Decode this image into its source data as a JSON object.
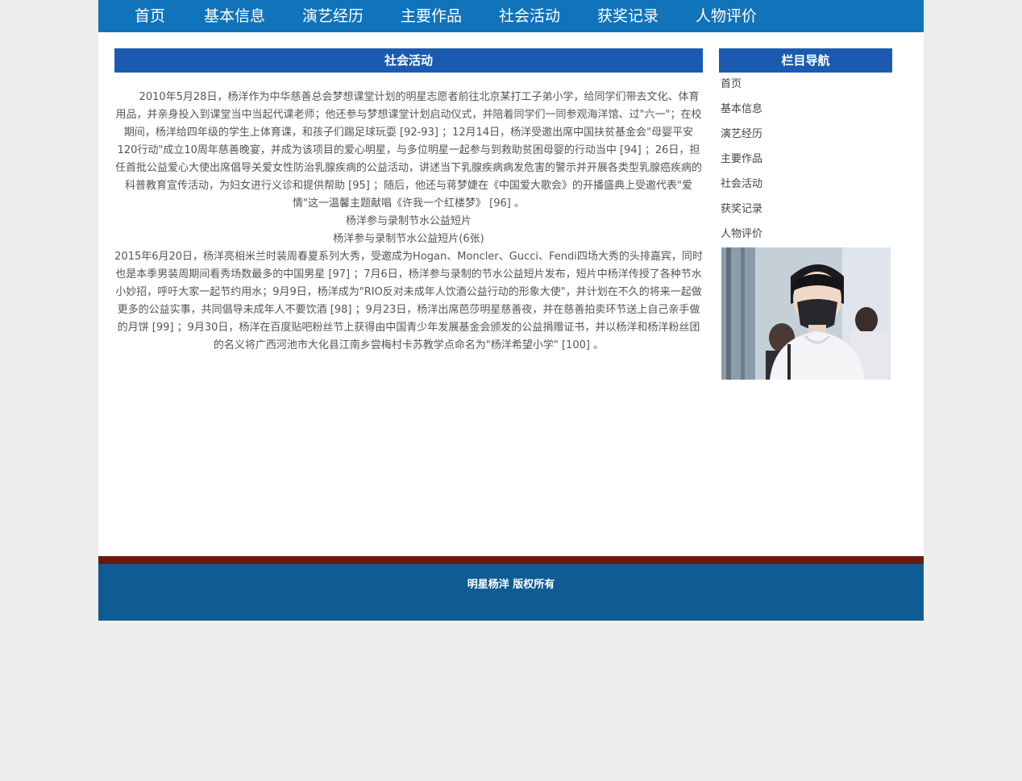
{
  "nav": {
    "items": [
      {
        "label": "首页"
      },
      {
        "label": "基本信息"
      },
      {
        "label": "演艺经历"
      },
      {
        "label": "主要作品"
      },
      {
        "label": "社会活动"
      },
      {
        "label": "获奖记录"
      },
      {
        "label": "人物评价"
      }
    ]
  },
  "main": {
    "title": "社会活动",
    "paragraphs": [
      "2010年5月28日，杨洋作为中华慈善总会梦想课堂计划的明星志愿者前往北京某打工子弟小学，给同学们带去文化、体育用品，并亲身投入到课堂当中当起代课老师；他还参与梦想课堂计划启动仪式，并陪着同学们一同参观海洋馆、过\"六一\"；在校期间，杨洋给四年级的学生上体育课，和孩子们踢足球玩耍 [92-93] ；12月14日，杨洋受邀出席中国扶贫基金会\"母婴平安120行动\"成立10周年慈善晚宴，并成为该项目的爱心明星，与多位明星一起参与到救助贫困母婴的行动当中 [94] ；26日，担任首批公益爱心大使出席倡导关爱女性防治乳腺疾病的公益活动，讲述当下乳腺疾病病发危害的警示并开展各类型乳腺癌疾病的科普教育宣传活动，为妇女进行义诊和提供帮助 [95] ；随后，他还与蒋梦婕在《中国爱大歌会》的开播盛典上受邀代表\"爱情\"这一温馨主题献唱《许我一个红楼梦》 [96] 。",
      "杨洋参与录制节水公益短片",
      "杨洋参与录制节水公益短片(6张)",
      "2015年6月20日，杨洋亮相米兰时装周春夏系列大秀，受邀成为Hogan、Moncler、Gucci、Fendi四场大秀的头排嘉宾，同时也是本季男装周期间看秀场数最多的中国男星 [97] ；7月6日，杨洋参与录制的节水公益短片发布，短片中杨洋传授了各种节水小妙招，呼吁大家一起节约用水；9月9日，杨洋成为\"RIO反对未成年人饮酒公益行动的形象大使\"，并计划在不久的将来一起做更多的公益实事，共同倡导未成年人不要饮酒 [98] ；9月23日，杨洋出席芭莎明星慈善夜，并在慈善拍卖环节送上自己亲手做的月饼 [99] ；9月30日，杨洋在百度贴吧粉丝节上获得由中国青少年发展基金会颁发的公益捐赠证书，并以杨洋和杨洋粉丝团的名义将广西河池市大化县江南乡尝梅村卡苏教学点命名为\"杨洋希望小学\" [100] 。"
    ]
  },
  "sidebar": {
    "title": "栏目导航",
    "links": [
      {
        "label": "首页"
      },
      {
        "label": "基本信息"
      },
      {
        "label": "演艺经历"
      },
      {
        "label": "主要作品"
      },
      {
        "label": "社会活动"
      },
      {
        "label": "获奖记录"
      },
      {
        "label": "人物评价"
      }
    ]
  },
  "footer": {
    "copyright": "明星杨洋 版权所有"
  },
  "colors": {
    "nav_bg": "#1173b9",
    "header_bg": "#1a5bb0",
    "footer_bg": "#0f5b94",
    "footer_stripe": "#6b1a0f",
    "page_bg": "#ededed"
  }
}
